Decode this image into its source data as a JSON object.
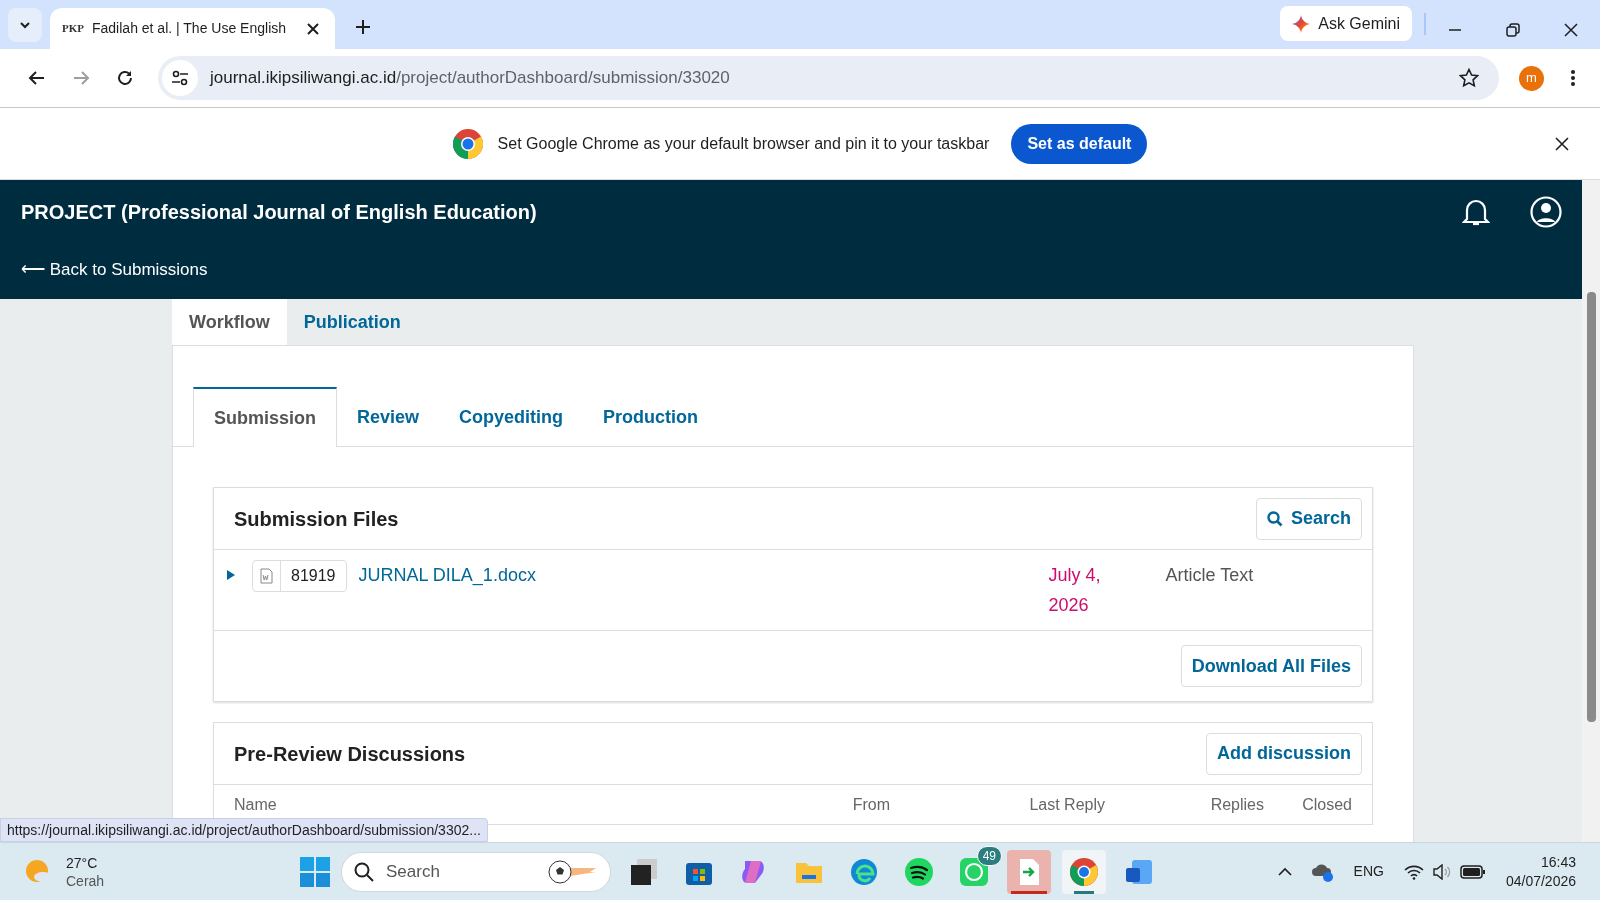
{
  "browser": {
    "tab": {
      "favicon": "PKP",
      "title": "Fadilah et al. | The Use English"
    },
    "gemini": "Ask Gemini",
    "url_host": "journal.ikipsiliwangi.ac.id",
    "url_path": "/project/authorDashboard/submission/33020",
    "profile": "m"
  },
  "banner": {
    "text": "Set Google Chrome as your default browser and pin it to your taskbar",
    "button": "Set as default"
  },
  "header": {
    "title": "PROJECT (Professional Journal of English Education)",
    "back": "⟵ Back to Submissions"
  },
  "tabs": [
    {
      "label": "Workflow",
      "selected": true
    },
    {
      "label": "Publication",
      "selected": false
    }
  ],
  "stage_tabs": [
    {
      "label": "Submission",
      "selected": true
    },
    {
      "label": "Review",
      "selected": false
    },
    {
      "label": "Copyediting",
      "selected": false
    },
    {
      "label": "Production",
      "selected": false
    }
  ],
  "files": {
    "title": "Submission Files",
    "search": "Search",
    "rows": [
      {
        "id": "81919",
        "name": "JURNAL DILA_1.docx",
        "date": "July 4, 2026",
        "type": "Article Text"
      }
    ],
    "download": "Download All Files"
  },
  "discussions": {
    "title": "Pre-Review Discussions",
    "add": "Add discussion",
    "columns": [
      "Name",
      "From",
      "Last Reply",
      "Replies",
      "Closed"
    ]
  },
  "status_url": "https://journal.ikipsiliwangi.ac.id/project/authorDashboard/submission/3302...",
  "taskbar": {
    "weather": {
      "temp": "27°C",
      "condition": "Cerah"
    },
    "search": "Search",
    "whatsapp_badge": "49",
    "language": "ENG",
    "time": "16:43",
    "date": "04/07/2026"
  }
}
